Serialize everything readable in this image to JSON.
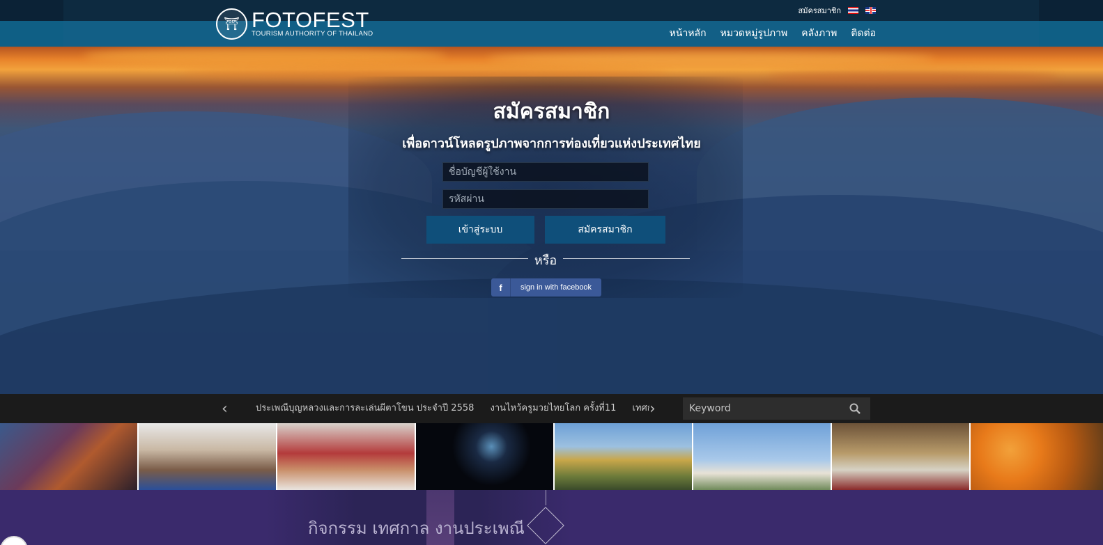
{
  "header": {
    "logo_title": "FOTOFEST",
    "logo_subtitle": "TOURISM AUTHORITY OF THAILAND",
    "top_member_link": "สมัครสมาชิก",
    "languages": [
      "th-flag-icon",
      "uk-flag-icon"
    ],
    "nav": [
      "หน้าหลัก",
      "หมวดหมู่รูปภาพ",
      "คลังภาพ",
      "ติดต่อ"
    ]
  },
  "signup": {
    "title": "สมัครสมาชิก",
    "subtitle": "เพื่อดาวน์โหลดรูปภาพจากการท่องเที่ยวแห่งประเทศไทย",
    "username_placeholder": "ชื่อบัญชีผู้ใช้งาน",
    "password_placeholder": "รหัสผ่าน",
    "login_button": "เข้าสู่ระบบ",
    "register_button": "สมัครสมาชิก",
    "or_text": "หรือ",
    "facebook_button": "sign in with facebook",
    "facebook_icon": "f"
  },
  "ticker": {
    "items": [
      "ประเพณีบุญหลวงและการละเล่นผีตาโขน ประจำปี 2558",
      "งานไหว้ครูมวยไทยโลก ครั้งที่11",
      "เทศกาลส"
    ],
    "prev_icon": "chevron-left-icon",
    "next_icon": "chevron-right-icon"
  },
  "search": {
    "placeholder": "Keyword",
    "icon": "search-icon"
  },
  "thumbnails": [
    "festival-elephant-thumbnail",
    "muay-thai-boxer-thumbnail",
    "muay-thai-ring-thumbnail",
    "fireworks-night-thumbnail",
    "procession-thumbnail",
    "pavilion-thumbnail",
    "market-stall-thumbnail",
    "marigold-flowers-thumbnail"
  ],
  "section": {
    "title": "กิจกรรม เทศกาล งานประเพณี"
  },
  "colors": {
    "nav_bar": "#125f86",
    "button": "#0f4f7a",
    "facebook": "#3b5998",
    "ticker_bg": "#1b1b1b",
    "section_bg": "#3a2a6c"
  }
}
